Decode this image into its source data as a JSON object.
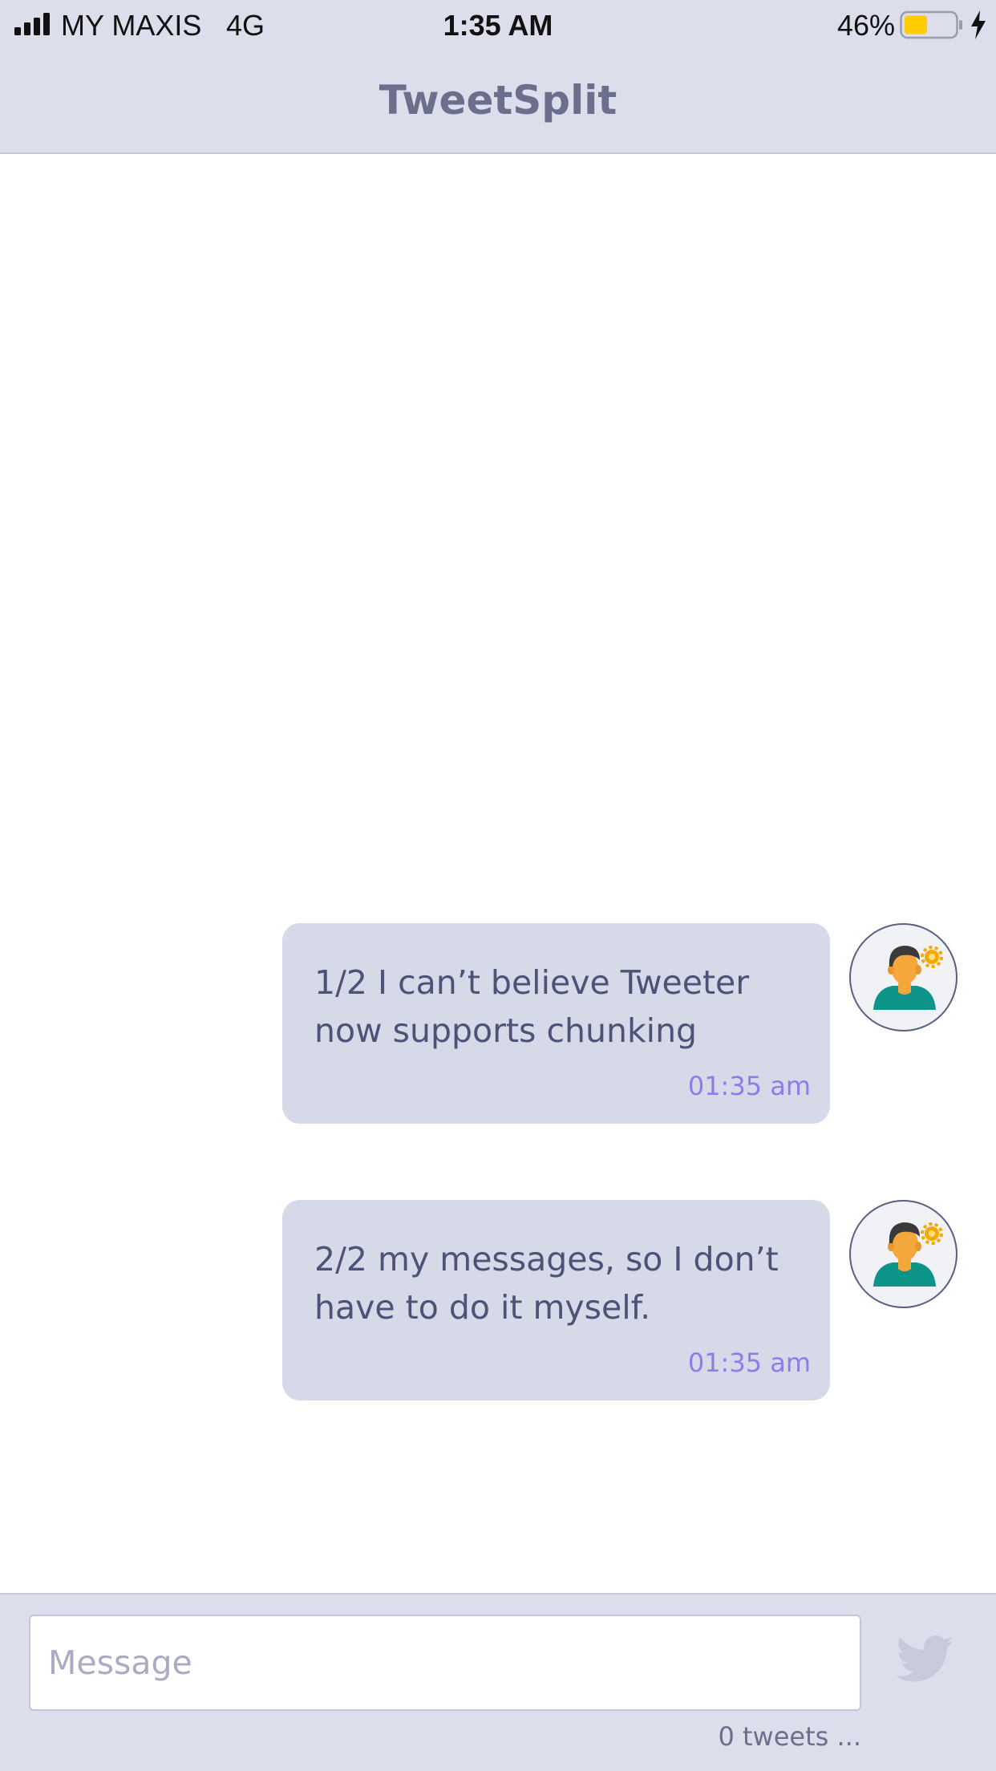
{
  "status_bar": {
    "carrier": "MY MAXIS",
    "network": "4G",
    "time": "1:35 AM",
    "battery_percent": "46%",
    "battery_level": 0.46
  },
  "header": {
    "title": "TweetSplit"
  },
  "messages": [
    {
      "text": "1/2 I can’t believe Tweeter now supports chunking",
      "time": "01:35 am",
      "avatar_icon": "user-avatar-icon"
    },
    {
      "text": "2/2 my messages, so I don’t have to do it myself.",
      "time": "01:35 am",
      "avatar_icon": "user-avatar-icon"
    }
  ],
  "composer": {
    "placeholder": "Message",
    "value": "",
    "send_icon": "twitter-bird-icon",
    "tweet_count": "0 tweets ..."
  },
  "colors": {
    "bar_background": "#dcdfeb",
    "bubble_background": "#d5d9e8",
    "text": "#4e5276",
    "timestamp": "#8c7de8",
    "battery_fill": "#ffcc00"
  }
}
